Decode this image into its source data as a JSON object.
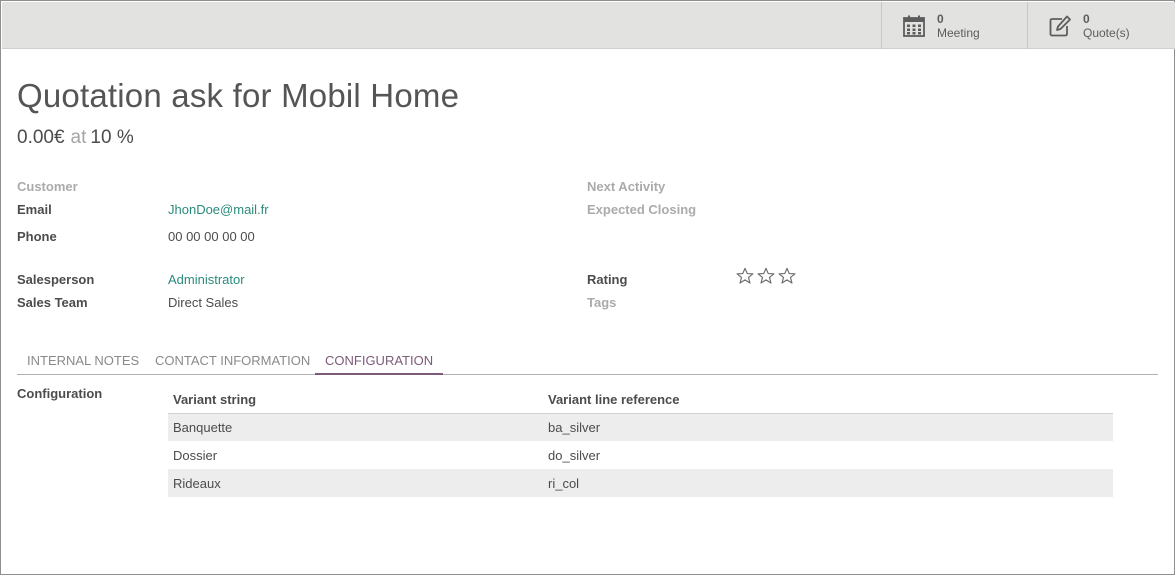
{
  "smart_buttons": {
    "meeting": {
      "count": "0",
      "label": "Meeting",
      "icon": "calendar-icon"
    },
    "quotes": {
      "count": "0",
      "label": "Quote(s)",
      "icon": "edit-icon"
    }
  },
  "record": {
    "title": "Quotation ask for Mobil Home",
    "amount": "0.00€",
    "at_word": "at",
    "probability": "10 %"
  },
  "fields_left": {
    "customer_label": "Customer",
    "email_label": "Email",
    "email_value": "JhonDoe@mail.fr",
    "phone_label": "Phone",
    "phone_value": "00 00 00 00 00",
    "salesperson_label": "Salesperson",
    "salesperson_value": "Administrator",
    "sales_team_label": "Sales Team",
    "sales_team_value": "Direct Sales"
  },
  "fields_right": {
    "next_activity_label": "Next Activity",
    "expected_closing_label": "Expected Closing",
    "rating_label": "Rating",
    "rating_value": 0,
    "rating_max": 3,
    "tags_label": "Tags"
  },
  "tabs": [
    {
      "label": "INTERNAL NOTES",
      "active": false
    },
    {
      "label": "CONTACT INFORMATION",
      "active": false
    },
    {
      "label": "CONFIGURATION",
      "active": true
    }
  ],
  "configuration": {
    "label": "Configuration",
    "columns": [
      "Variant string",
      "Variant line reference"
    ],
    "rows": [
      [
        "Banquette",
        "ba_silver"
      ],
      [
        "Dossier",
        "do_silver"
      ],
      [
        "Rideaux",
        "ri_col"
      ]
    ]
  },
  "colors": {
    "link": "#2a8c7c",
    "tab_active": "#7c5b7a",
    "topbar": "#e2e2e0",
    "row_stripe": "#ededed"
  }
}
